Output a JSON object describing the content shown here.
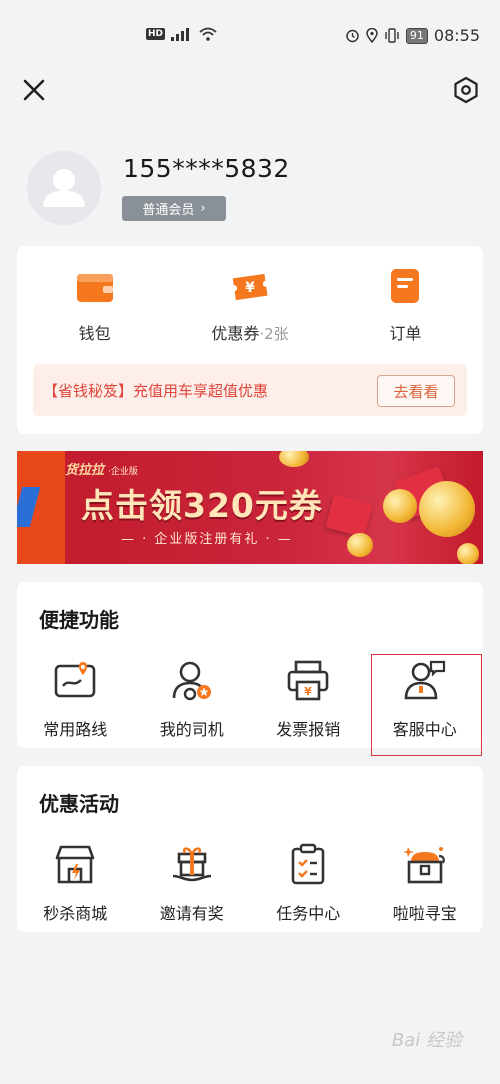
{
  "status_bar": {
    "left": "HD ⁴⁶ᴳ",
    "battery": "91",
    "time": "08:55"
  },
  "profile": {
    "phone": "155****5832",
    "member_label": "普通会员",
    "member_chevron": "›"
  },
  "wallet": {
    "items": [
      {
        "label": "钱包",
        "sub": "",
        "icon": "wallet-icon"
      },
      {
        "label": "优惠券",
        "sub": "·2张",
        "icon": "coupon-icon"
      },
      {
        "label": "订单",
        "sub": "",
        "icon": "order-icon"
      }
    ],
    "promo_text": "【省钱秘笈】充值用车享超值优惠",
    "promo_button": "去看看"
  },
  "banner": {
    "brand": "货拉拉",
    "brand_sub": "·企业版",
    "title": "点击领320元券",
    "subtitle": "— · 企业版注册有礼 · —"
  },
  "quick": {
    "title": "便捷功能",
    "items": [
      {
        "label": "常用路线",
        "icon": "route-map-icon"
      },
      {
        "label": "我的司机",
        "icon": "driver-icon"
      },
      {
        "label": "发票报销",
        "icon": "invoice-printer-icon"
      },
      {
        "label": "客服中心",
        "icon": "customer-service-icon"
      }
    ]
  },
  "activities": {
    "title": "优惠活动",
    "items": [
      {
        "label": "秒杀商城",
        "icon": "flash-sale-store-icon"
      },
      {
        "label": "邀请有奖",
        "icon": "invite-gift-icon"
      },
      {
        "label": "任务中心",
        "icon": "task-clipboard-icon"
      },
      {
        "label": "啦啦寻宝",
        "icon": "treasure-box-icon"
      }
    ]
  },
  "watermark": "Bai 经验",
  "colors": {
    "accent_orange": "#f5781e",
    "promo_red": "#e0463c",
    "highlight_red": "#d9363e"
  }
}
